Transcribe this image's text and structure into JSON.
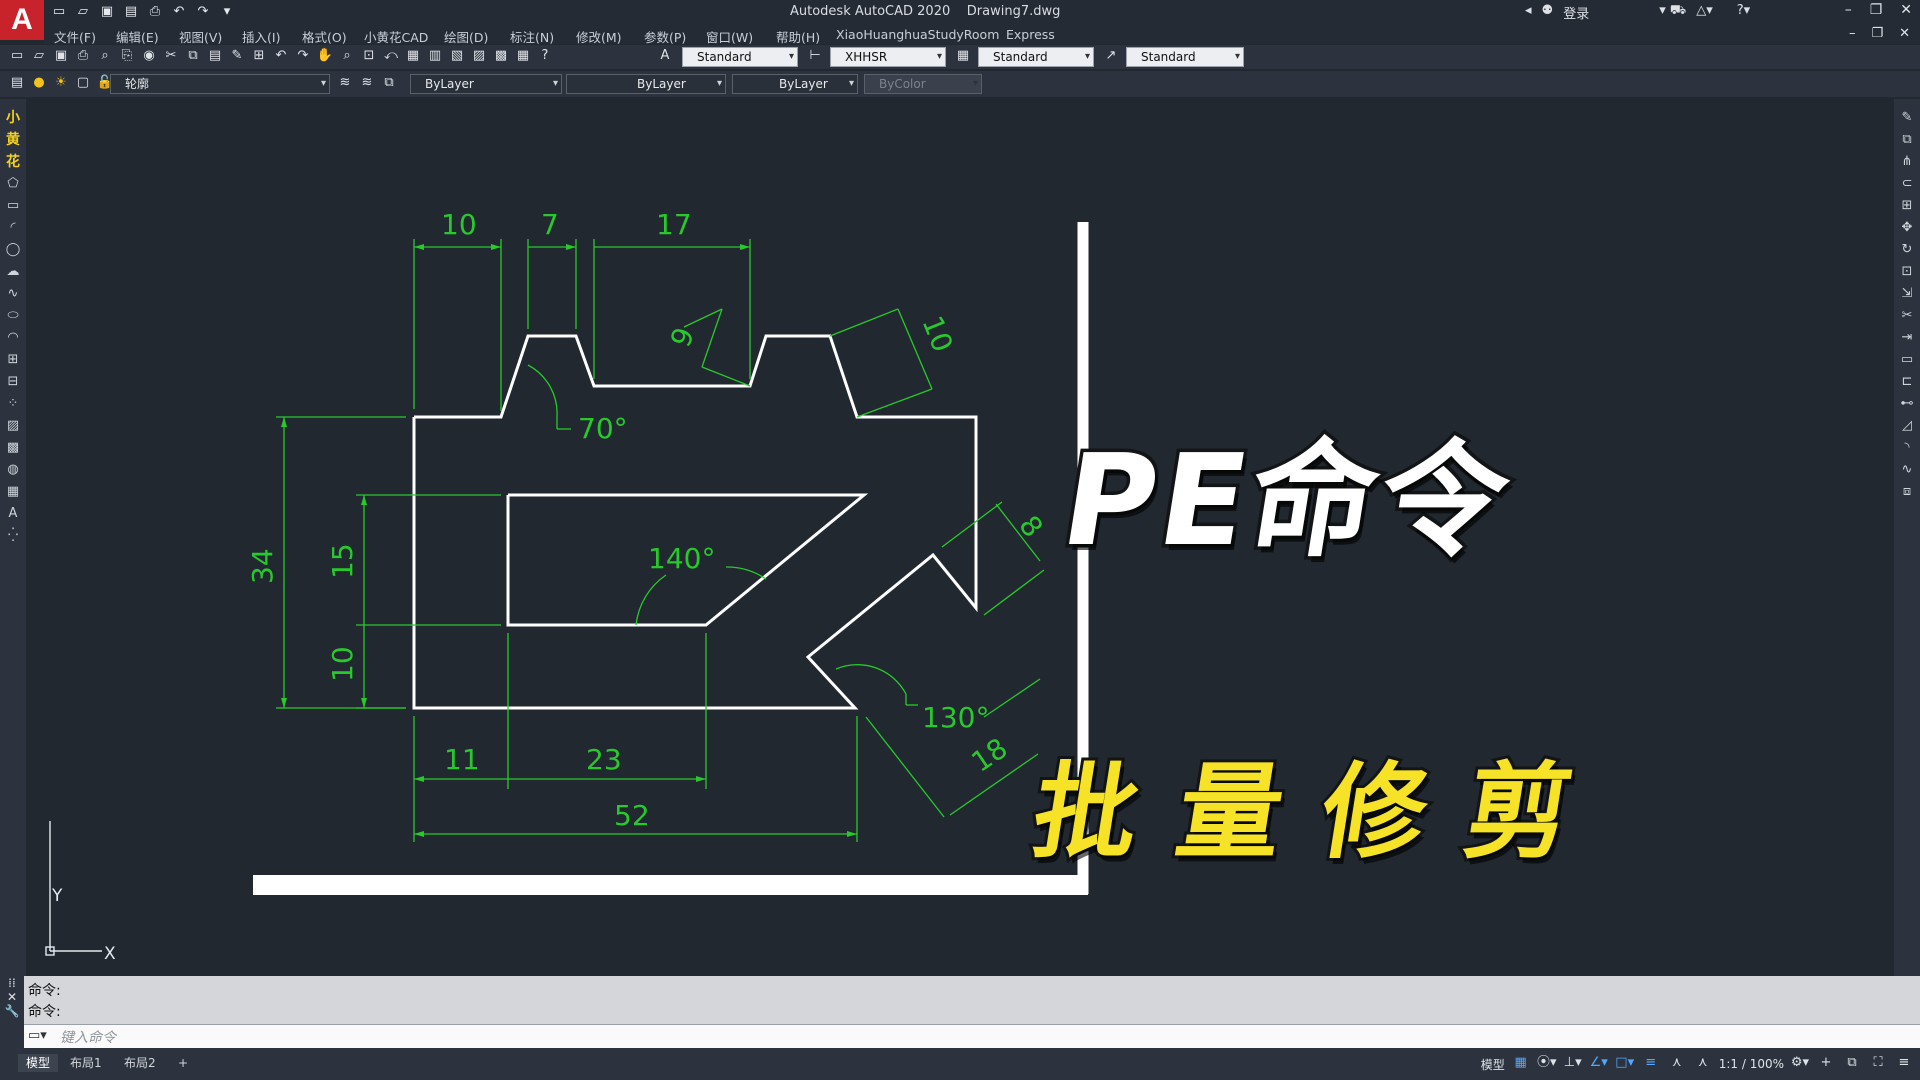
{
  "titlebar": {
    "logo": "A",
    "app_title": "Autodesk AutoCAD 2020    Drawing7.dwg",
    "signin": "登录",
    "qat_icons": [
      "new-icon",
      "open-icon",
      "save-icon",
      "saveas-icon",
      "plot-icon",
      "undo-icon",
      "redo-icon"
    ]
  },
  "menu": {
    "items": [
      "文件(F)",
      "编辑(E)",
      "视图(V)",
      "插入(I)",
      "格式(O)",
      "小黄花CAD",
      "绘图(D)",
      "标注(N)",
      "修改(M)",
      "参数(P)",
      "窗口(W)",
      "帮助(H)",
      "XiaoHuanghuaStudyRoom",
      "Express"
    ]
  },
  "styles": {
    "text_style": "Standard",
    "dim_style": "XHHSR",
    "table_style": "Standard",
    "mleader_style": "Standard"
  },
  "layers": {
    "current_layer": "轮廓",
    "color": "ByLayer",
    "linetype": "ByLayer",
    "lineweight": "ByLayer",
    "plotstyle": "ByColor"
  },
  "left_toolbar_chars": [
    "小",
    "黄",
    "花"
  ],
  "drawing": {
    "dimensions": [
      "10",
      "7",
      "17",
      "9",
      "10",
      "70°",
      "34",
      "15",
      "10",
      "140°",
      "8",
      "130°",
      "18",
      "11",
      "23",
      "52"
    ],
    "ucs_y": "Y",
    "ucs_x": "X"
  },
  "overlay": {
    "headline": "PE命令",
    "subline": "批量修剪"
  },
  "command": {
    "history": [
      "命令:",
      "命令:"
    ],
    "placeholder": "键入命令"
  },
  "status": {
    "tabs": [
      "模型",
      "布局1",
      "布局2"
    ],
    "model_label": "模型",
    "scale": "1:1 / 100%"
  },
  "colors": {
    "background": "#212830",
    "geometry": "#ffffff",
    "dimension": "#28c92c",
    "accent_yellow": "#f6e226"
  }
}
